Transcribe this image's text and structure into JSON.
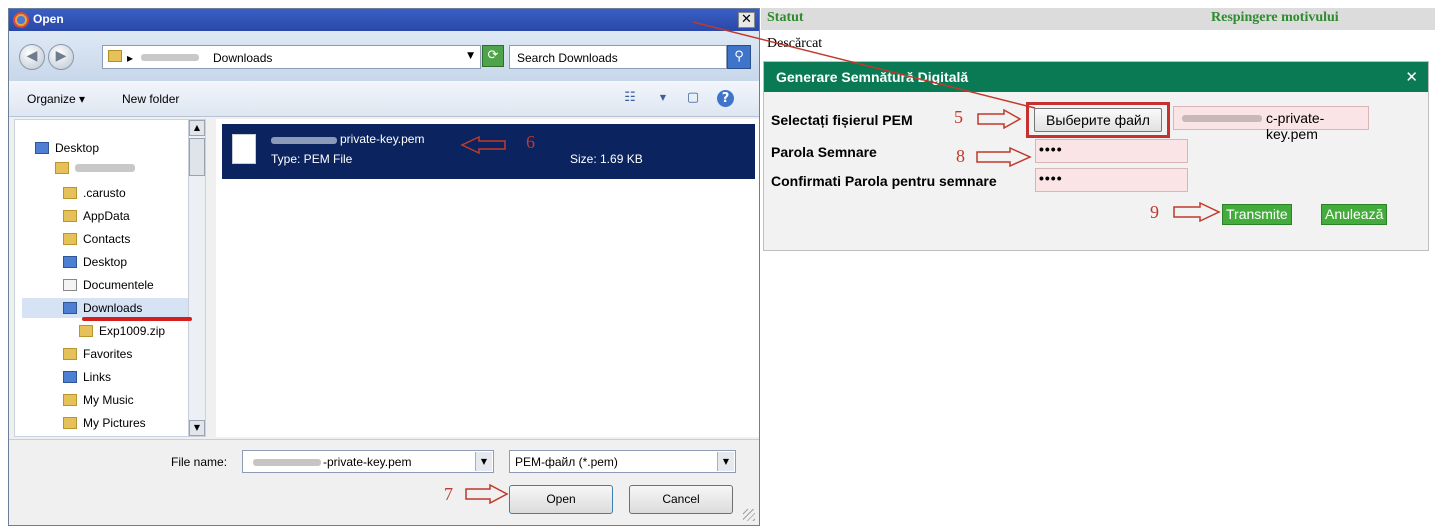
{
  "dialog": {
    "title": "Open",
    "close_glyph": "✕",
    "nav": {
      "back_glyph": "◀",
      "forward_glyph": "▶"
    },
    "address": {
      "crumb": "Downloads",
      "crumb_sep": "▸",
      "dropdown_glyph": "▼"
    },
    "refresh_glyph": "⟳",
    "search": {
      "placeholder": "Search Downloads",
      "button_glyph": "⚲"
    },
    "commands": {
      "organize": "Organize ▾",
      "new_folder": "New folder",
      "views_glyph": "☷",
      "preview_glyph": "▢",
      "help_glyph": "?"
    },
    "tree": {
      "items": [
        {
          "label": "Desktop"
        },
        {
          "label": ""
        },
        {
          "label": ".carusto"
        },
        {
          "label": "AppData"
        },
        {
          "label": "Contacts"
        },
        {
          "label": "Desktop"
        },
        {
          "label": "Documentele"
        },
        {
          "label": "Downloads"
        },
        {
          "label": "Exp1009.zip"
        },
        {
          "label": "Favorites"
        },
        {
          "label": "Links"
        },
        {
          "label": "My Music"
        },
        {
          "label": "My Pictures"
        }
      ]
    },
    "file": {
      "name_suffix": "private-key.pem",
      "type": "Type: PEM File",
      "size": "Size: 1.69 KB"
    },
    "bottom": {
      "file_name_label": "File name:",
      "file_name_value": "-private-key.pem",
      "type_value": "PEM-файл (*.pem)",
      "open_label": "Open",
      "cancel_label": "Cancel"
    }
  },
  "web": {
    "header": {
      "col1": "Statut",
      "col2": "Respingere motivului"
    },
    "status_text": "Descărcat",
    "modal": {
      "title": "Generare Semnătură Digitală",
      "close_glyph": "✕",
      "pem_label": "Selectați fișierul PEM",
      "choose_button": "Выберите файл",
      "pem_value": "c-private-key.pem",
      "password_label": "Parola Semnare",
      "password_value": "••••",
      "confirm_label": "Confirmati Parola pentru semnare",
      "confirm_value": "••••",
      "transmit": "Transmite",
      "cancel": "Anulează"
    }
  },
  "annotations": {
    "n5": "5",
    "n6": "6",
    "n7": "7",
    "n8": "8",
    "n9": "9"
  },
  "colors": {
    "annotation_red": "#c0392b",
    "modal_green": "#0a7a54",
    "button_green": "#44ac3c",
    "header_green": "#2e8b2e",
    "selection_navy": "#0b245f"
  }
}
